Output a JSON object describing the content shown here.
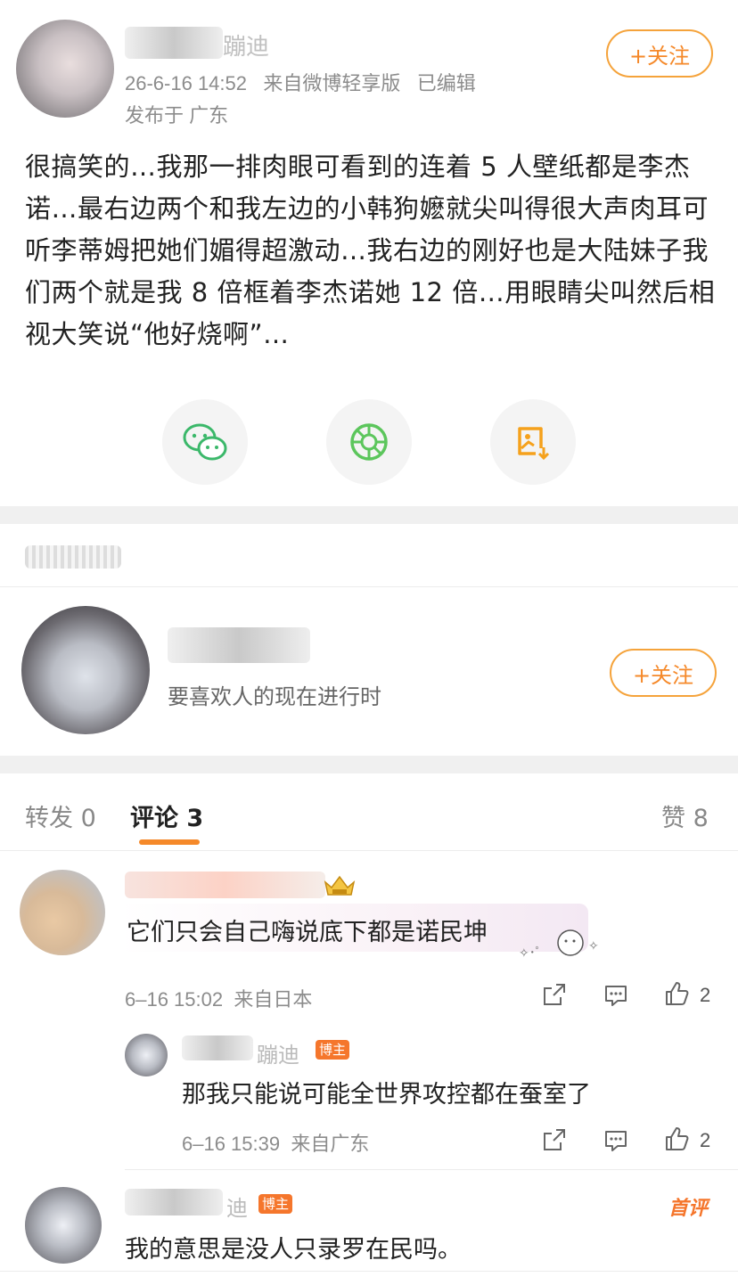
{
  "post": {
    "author_name_partial": "蹦迪",
    "timestamp": "26-6-16 14:52",
    "source": "来自微博轻享版",
    "edited": "已编辑",
    "location": "发布于 广东",
    "follow_label": "+关注",
    "body": "很搞笑的…我那一排肉眼可看到的连着 5 人壁纸都是李杰诺…最右边两个和我左边的小韩狗嬷就尖叫得很大声肉耳可听李蒂姆把她们媚得超激动…我右边的刚好也是大陆妹子我们两个就是我 8 倍框着李杰诺她 12 倍…用眼睛尖叫然后相视大笑说“他好烧啊”…"
  },
  "share": [
    {
      "name": "wechat",
      "color": "#3bb86a"
    },
    {
      "name": "moments",
      "color": "#5cc65c"
    },
    {
      "name": "save-image",
      "color": "#f5a11c"
    }
  ],
  "profile_card": {
    "bio": "要喜欢人的现在进行时",
    "follow_label": "+关注"
  },
  "tabs": {
    "repost": "转发 0",
    "comment": "评论 3",
    "like": "赞 8"
  },
  "comments": [
    {
      "text": "它们只会自己嗨说底下都是诺民坤",
      "time": "6–16 15:02",
      "source": "来自日本",
      "likes": "2"
    },
    {
      "name_partial": "蹦迪",
      "badge": "博主",
      "text": "那我只能说可能全世界攻控都在蚕室了",
      "time": "6–16 15:39",
      "source": "来自广东",
      "likes": "2"
    },
    {
      "name_partial": "迪",
      "badge": "博主",
      "first_tag": "首评",
      "text": "我的意思是没人只录罗在民吗。"
    }
  ],
  "colors": {
    "accent": "#f5892a",
    "badge": "#f5762c",
    "tab_underline": "#f5892a"
  }
}
